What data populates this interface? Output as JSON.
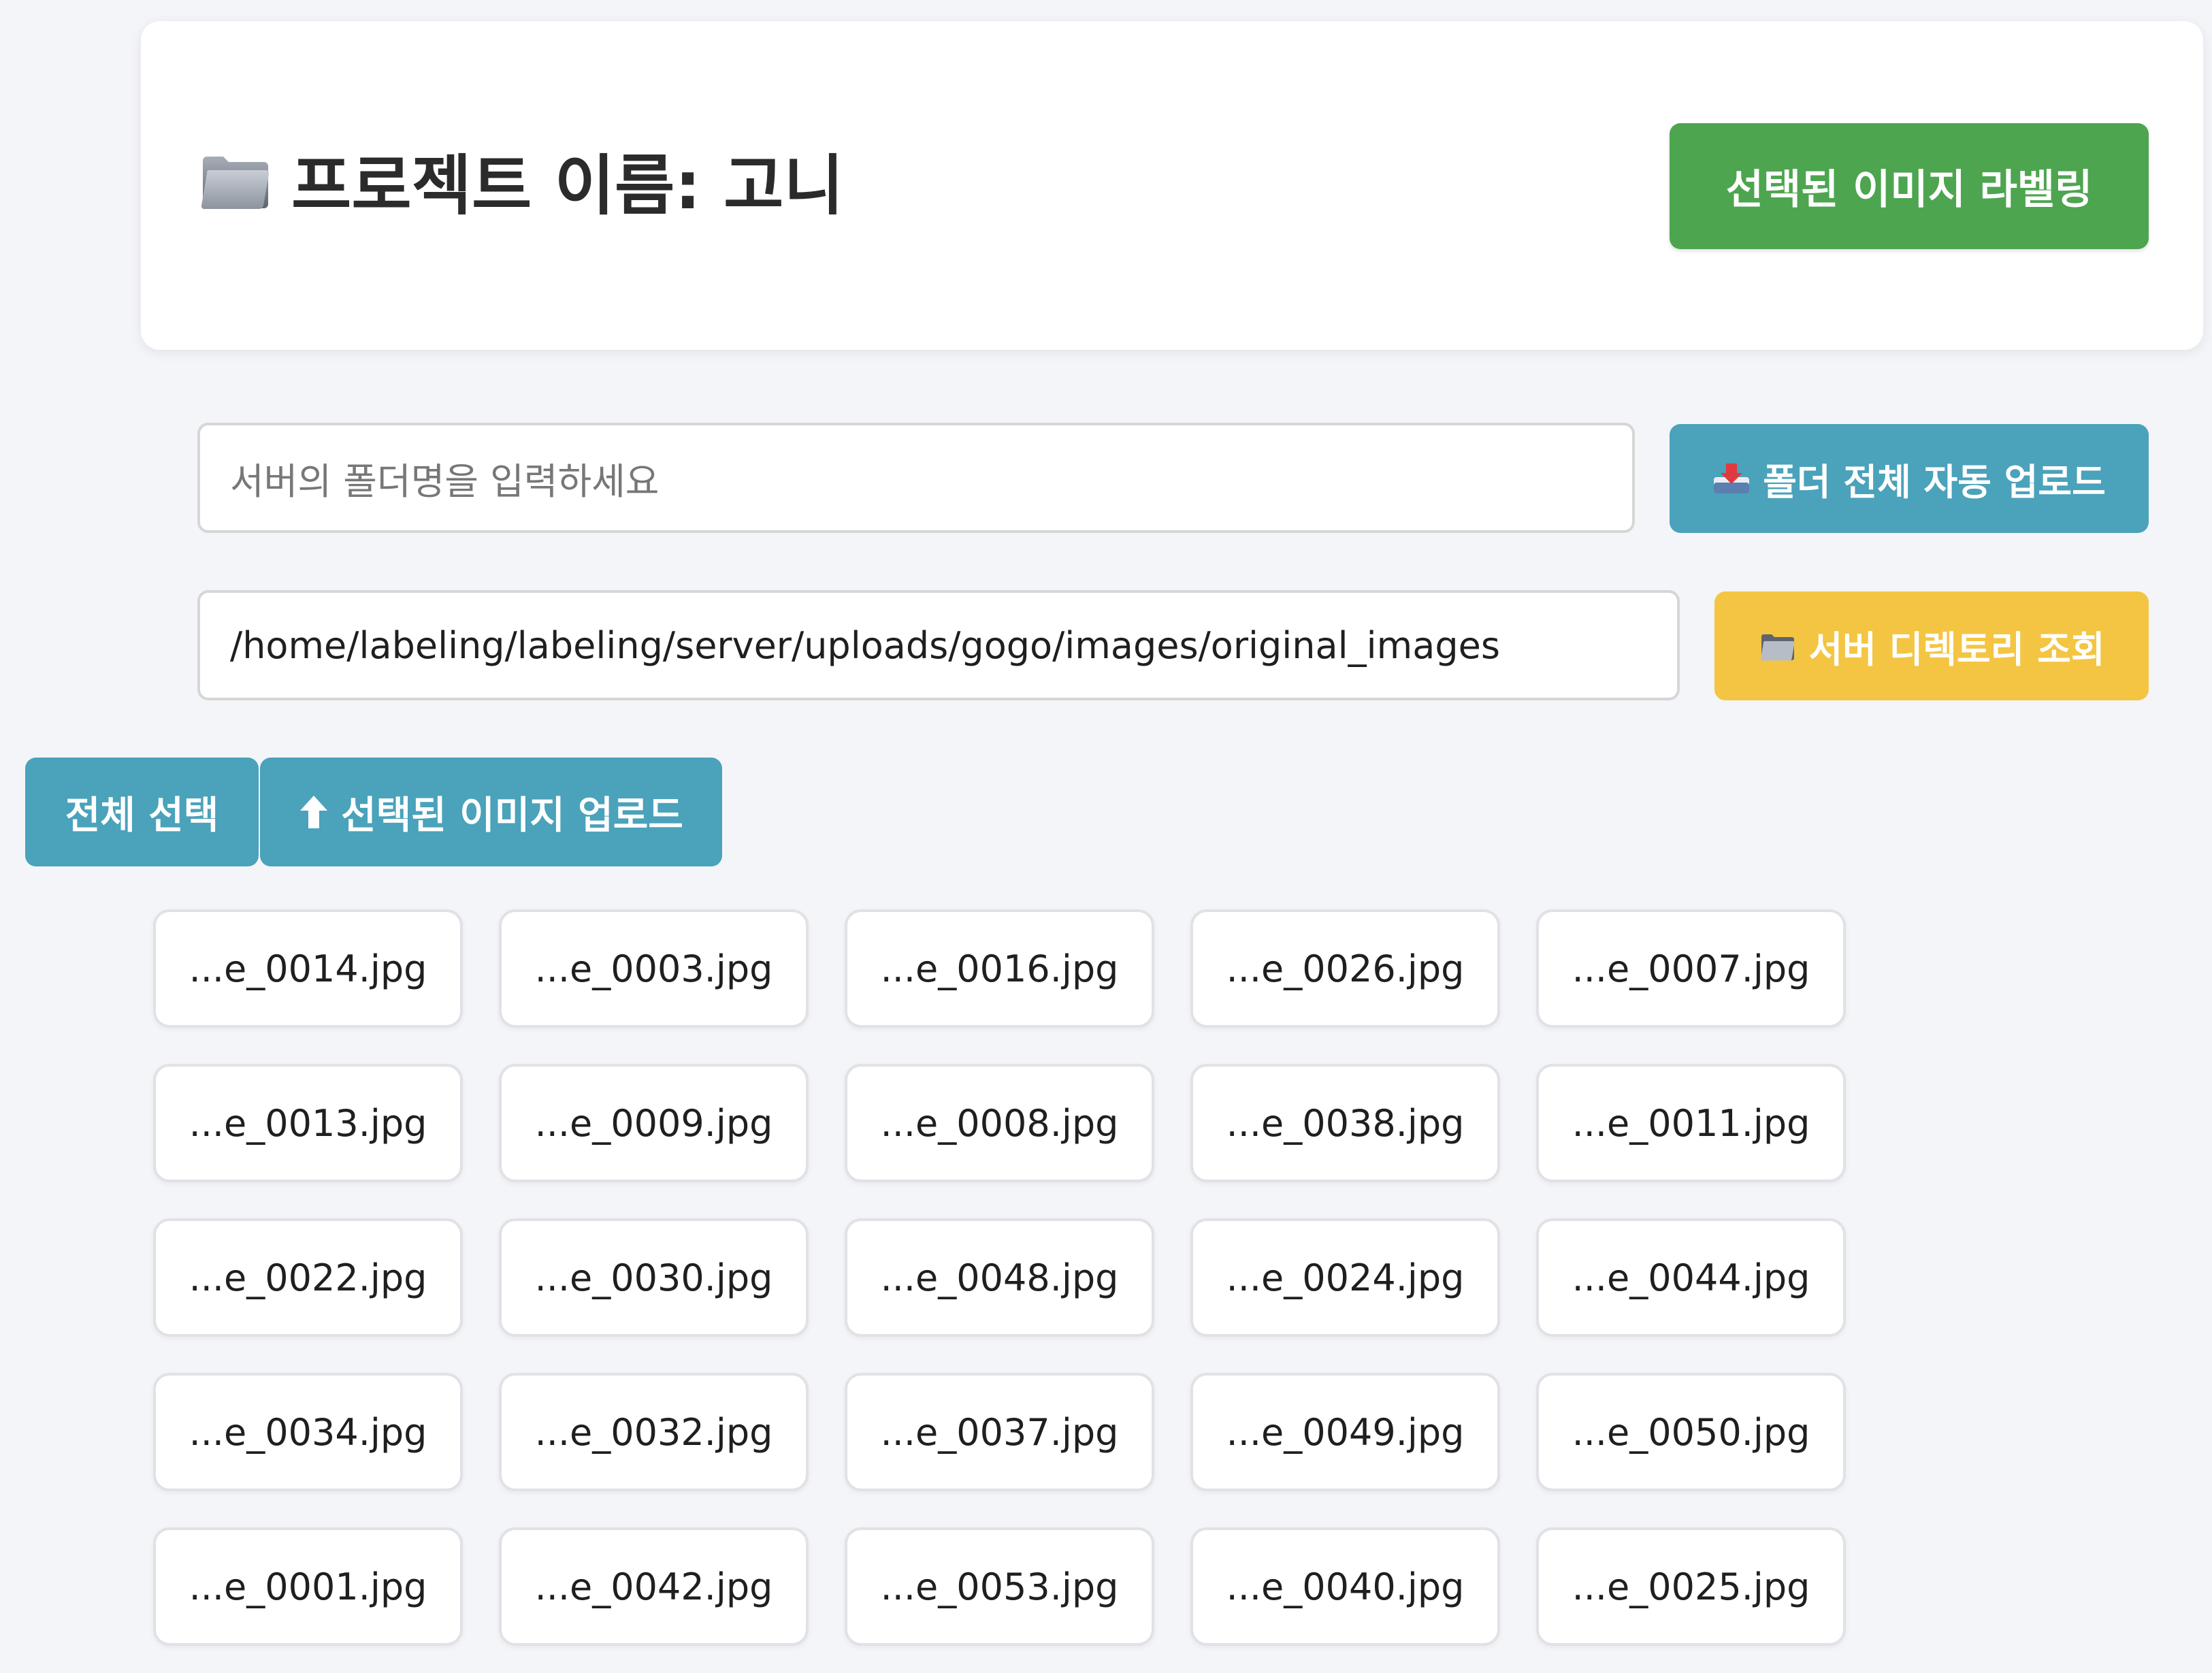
{
  "header": {
    "title": "프로젝트 이름: 고니",
    "label_button": "선택된 이미지 라벨링"
  },
  "folder_upload": {
    "placeholder": "서버의 폴더명을 입력하세요",
    "button_label": "폴더 전체 자동 업로드",
    "button_icon": "inbox-tray-icon"
  },
  "directory": {
    "path_value": "/home/labeling/labeling/server/uploads/gogo/images/original_images",
    "button_label": "서버 디렉토리 조회",
    "button_icon": "folder-icon"
  },
  "actions": {
    "select_all_label": "전체 선택",
    "upload_selected_label": "선택된 이미지 업로드",
    "upload_icon": "up-arrow-icon"
  },
  "files": [
    "...e_0014.jpg",
    "...e_0003.jpg",
    "...e_0016.jpg",
    "...e_0026.jpg",
    "...e_0007.jpg",
    "...e_0013.jpg",
    "...e_0009.jpg",
    "...e_0008.jpg",
    "...e_0038.jpg",
    "...e_0011.jpg",
    "...e_0022.jpg",
    "...e_0030.jpg",
    "...e_0048.jpg",
    "...e_0024.jpg",
    "...e_0044.jpg",
    "...e_0034.jpg",
    "...e_0032.jpg",
    "...e_0037.jpg",
    "...e_0049.jpg",
    "...e_0050.jpg",
    "...e_0001.jpg",
    "...e_0042.jpg",
    "...e_0053.jpg",
    "...e_0040.jpg",
    "...e_0025.jpg"
  ],
  "colors": {
    "background": "#f4f5f9",
    "green": "#4da54f",
    "teal": "#4aa2bb",
    "yellow": "#f4c542"
  }
}
